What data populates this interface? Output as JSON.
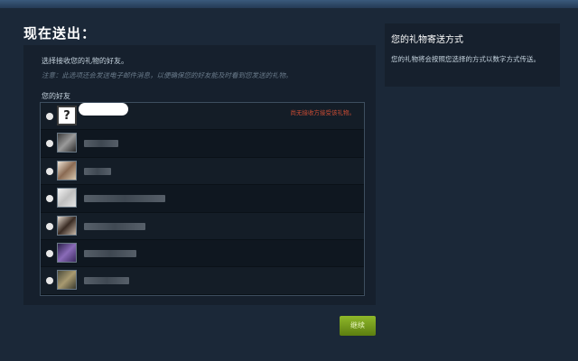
{
  "page": {
    "title": "现在送出："
  },
  "main": {
    "instruction": "选择接收您的礼物的好友。",
    "note": "注意：此选项还会发送电子邮件消息，以便确保您的好友能及时看到您发送的礼物。",
    "friends_label": "您的好友",
    "friends": [
      {
        "avatar_icon": "unknown-user-icon",
        "avatar_glyph": "?",
        "name": "",
        "status": "尚无接收方接受该礼物。"
      },
      {
        "avatar_icon": "friend-avatar-icon",
        "name": "",
        "status": ""
      },
      {
        "avatar_icon": "friend-avatar-icon",
        "name": "",
        "status": ""
      },
      {
        "avatar_icon": "friend-avatar-icon",
        "name": "",
        "status": ""
      },
      {
        "avatar_icon": "friend-avatar-icon",
        "name": "",
        "status": ""
      },
      {
        "avatar_icon": "friend-avatar-icon",
        "name": "",
        "status": ""
      },
      {
        "avatar_icon": "friend-avatar-icon",
        "name": "",
        "status": ""
      }
    ]
  },
  "side": {
    "title": "您的礼物寄送方式",
    "text": "您的礼物将会按照您选择的方式以数字方式传送。"
  },
  "actions": {
    "continue_label": "继续"
  },
  "colors": {
    "background": "#1b2838",
    "panel": "#16202d",
    "status_red": "#ce4d34",
    "button_green": "#7ea51f"
  }
}
